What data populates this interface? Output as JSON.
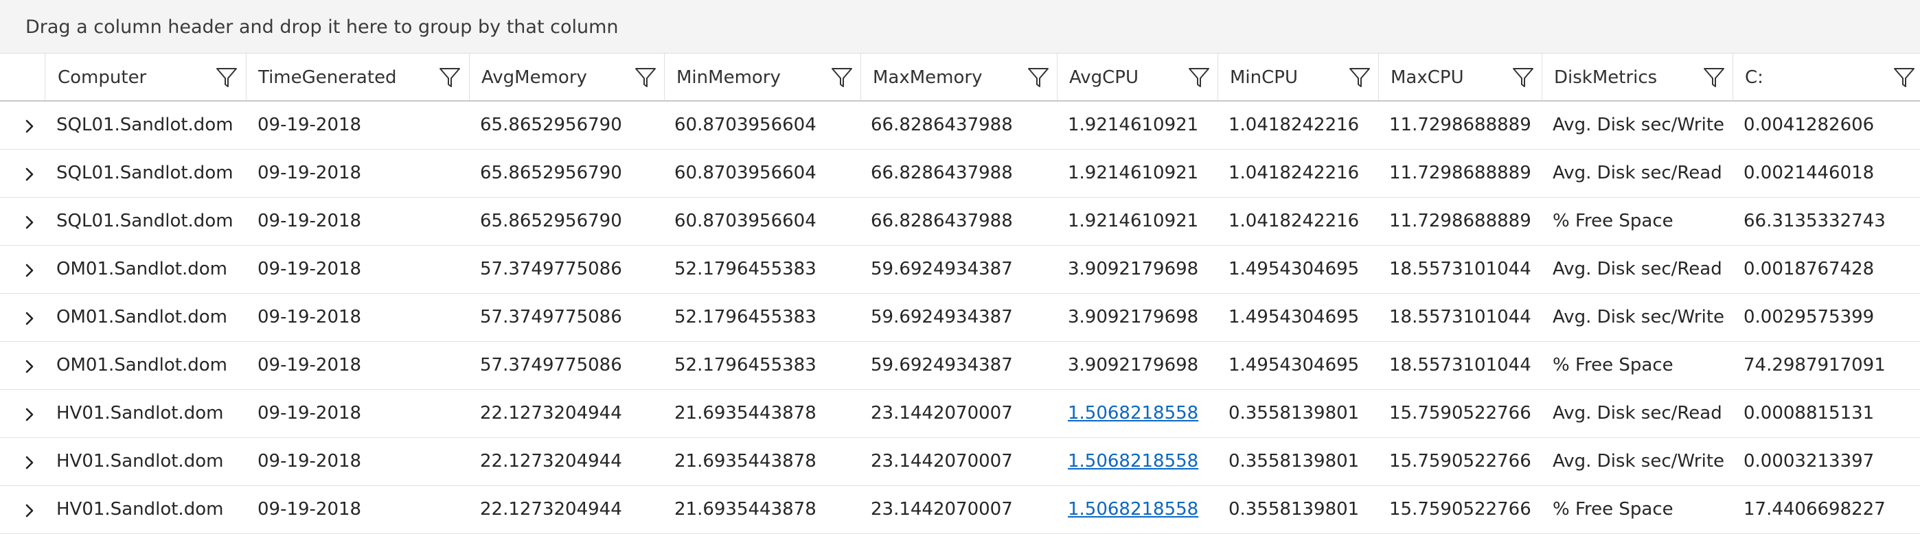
{
  "group_bar": {
    "text": "Drag a column header and drop it here to group by that column"
  },
  "columns": [
    {
      "label": "Computer"
    },
    {
      "label": "TimeGenerated"
    },
    {
      "label": "AvgMemory"
    },
    {
      "label": "MinMemory"
    },
    {
      "label": "MaxMemory"
    },
    {
      "label": "AvgCPU"
    },
    {
      "label": "MinCPU"
    },
    {
      "label": "MaxCPU"
    },
    {
      "label": "DiskMetrics"
    },
    {
      "label": "C:"
    }
  ],
  "rows": [
    {
      "computer": "SQL01.Sandlot.dom",
      "time": "09-19-2018",
      "avgmem": "65.8652956790",
      "minmem": "60.8703956604",
      "maxmem": "66.8286437988",
      "avgcpu": "1.9214610921",
      "mincpu": "1.0418242216",
      "maxcpu": "11.7298688889",
      "disk": "Avg. Disk sec/Write",
      "c": "0.0041282606"
    },
    {
      "computer": "SQL01.Sandlot.dom",
      "time": "09-19-2018",
      "avgmem": "65.8652956790",
      "minmem": "60.8703956604",
      "maxmem": "66.8286437988",
      "avgcpu": "1.9214610921",
      "mincpu": "1.0418242216",
      "maxcpu": "11.7298688889",
      "disk": "Avg. Disk sec/Read",
      "c": "0.0021446018"
    },
    {
      "computer": "SQL01.Sandlot.dom",
      "time": "09-19-2018",
      "avgmem": "65.8652956790",
      "minmem": "60.8703956604",
      "maxmem": "66.8286437988",
      "avgcpu": "1.9214610921",
      "mincpu": "1.0418242216",
      "maxcpu": "11.7298688889",
      "disk": "% Free Space",
      "c": "66.3135332743"
    },
    {
      "computer": "OM01.Sandlot.dom",
      "time": "09-19-2018",
      "avgmem": "57.3749775086",
      "minmem": "52.1796455383",
      "maxmem": "59.6924934387",
      "avgcpu": "3.9092179698",
      "mincpu": "1.4954304695",
      "maxcpu": "18.5573101044",
      "disk": "Avg. Disk sec/Read",
      "c": "0.0018767428"
    },
    {
      "computer": "OM01.Sandlot.dom",
      "time": "09-19-2018",
      "avgmem": "57.3749775086",
      "minmem": "52.1796455383",
      "maxmem": "59.6924934387",
      "avgcpu": "3.9092179698",
      "mincpu": "1.4954304695",
      "maxcpu": "18.5573101044",
      "disk": "Avg. Disk sec/Write",
      "c": "0.0029575399"
    },
    {
      "computer": "OM01.Sandlot.dom",
      "time": "09-19-2018",
      "avgmem": "57.3749775086",
      "minmem": "52.1796455383",
      "maxmem": "59.6924934387",
      "avgcpu": "3.9092179698",
      "mincpu": "1.4954304695",
      "maxcpu": "18.5573101044",
      "disk": "% Free Space",
      "c": "74.2987917091"
    },
    {
      "computer": "HV01.Sandlot.dom",
      "time": "09-19-2018",
      "avgmem": "22.1273204944",
      "minmem": "21.6935443878",
      "maxmem": "23.1442070007",
      "avgcpu": "1.5068218558",
      "mincpu": "0.3558139801",
      "maxcpu": "15.7590522766",
      "disk": "Avg. Disk sec/Read",
      "c": "0.0008815131"
    },
    {
      "computer": "HV01.Sandlot.dom",
      "time": "09-19-2018",
      "avgmem": "22.1273204944",
      "minmem": "21.6935443878",
      "maxmem": "23.1442070007",
      "avgcpu": "1.5068218558",
      "mincpu": "0.3558139801",
      "maxcpu": "15.7590522766",
      "disk": "Avg. Disk sec/Write",
      "c": "0.0003213397"
    },
    {
      "computer": "HV01.Sandlot.dom",
      "time": "09-19-2018",
      "avgmem": "22.1273204944",
      "minmem": "21.6935443878",
      "maxmem": "23.1442070007",
      "avgcpu": "1.5068218558",
      "mincpu": "0.3558139801",
      "maxcpu": "15.7590522766",
      "disk": "% Free Space",
      "c": "17.4406698227"
    }
  ],
  "icons": {
    "expander": "chevron-right-icon",
    "filter": "filter-icon"
  },
  "colors": {
    "link": "#0b67c4",
    "group_bar_bg": "#f4f4f4"
  }
}
